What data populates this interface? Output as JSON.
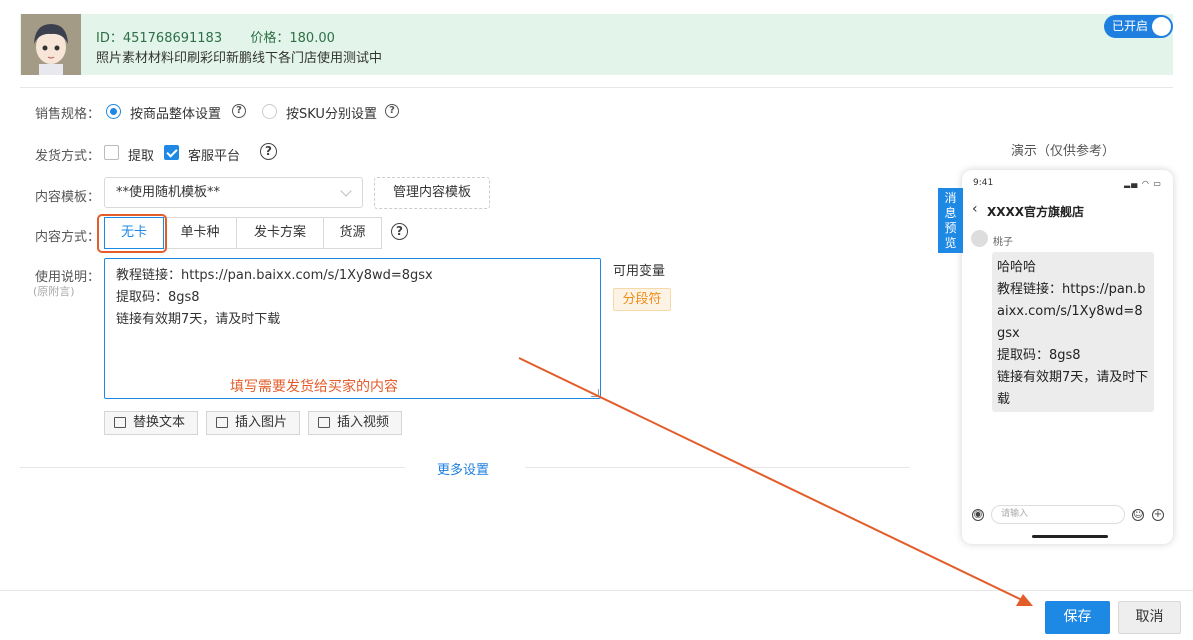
{
  "product": {
    "id_line": "ID：451768691183",
    "price_line": "价格：180.00",
    "title": "照片素材材料印刷彩印新鹏线下各门店使用测试中",
    "toggle_label": "已开启"
  },
  "form": {
    "sale_spec_label": "销售规格：",
    "sale_spec_opt1": "按商品整体设置",
    "sale_spec_opt2": "按SKU分别设置",
    "ship_label": "发货方式：",
    "ship_opt1": "提取",
    "ship_opt2": "客服平台",
    "template_label": "内容模板：",
    "template_value": "**使用随机模板**",
    "manage_template": "管理内容模板",
    "content_mode_label": "内容方式：",
    "content_modes": [
      "无卡",
      "单卡种",
      "发卡方案",
      "货源"
    ],
    "content_mode_selected": "无卡",
    "usage_label": "使用说明：",
    "usage_sub": "(原附言)",
    "usage_lines": [
      "教程链接：https://pan.baixx.com/s/1Xy8wd=8gsx",
      "提取码：8gs8",
      "链接有效期7天，请及时下载"
    ],
    "hint": "填写需要发货给买家的内容",
    "vars_label": "可用变量",
    "var_tag": "分段符",
    "tools": [
      "替换文本",
      "插入图片",
      "插入视频"
    ],
    "more_settings": "更多设置"
  },
  "preview": {
    "demo_label": "演示（仅供参考）",
    "side_tab": [
      "消",
      "息",
      "预",
      "览"
    ],
    "time": "9:41",
    "store": "XXXX官方旗舰店",
    "sender": "桃子",
    "bubble_lines": [
      "哈哈哈",
      "教程链接：https://pan.baixx.com/s/1Xy8wd=8gsx",
      "提取码：8gs8",
      "链接有效期7天，请及时下载"
    ],
    "input_placeholder": "请输入"
  },
  "footer": {
    "save": "保存",
    "cancel": "取消"
  },
  "colors": {
    "accent": "#1e88e5",
    "banner_bg": "#e3f5ea",
    "annotation": "#e35d2b"
  }
}
